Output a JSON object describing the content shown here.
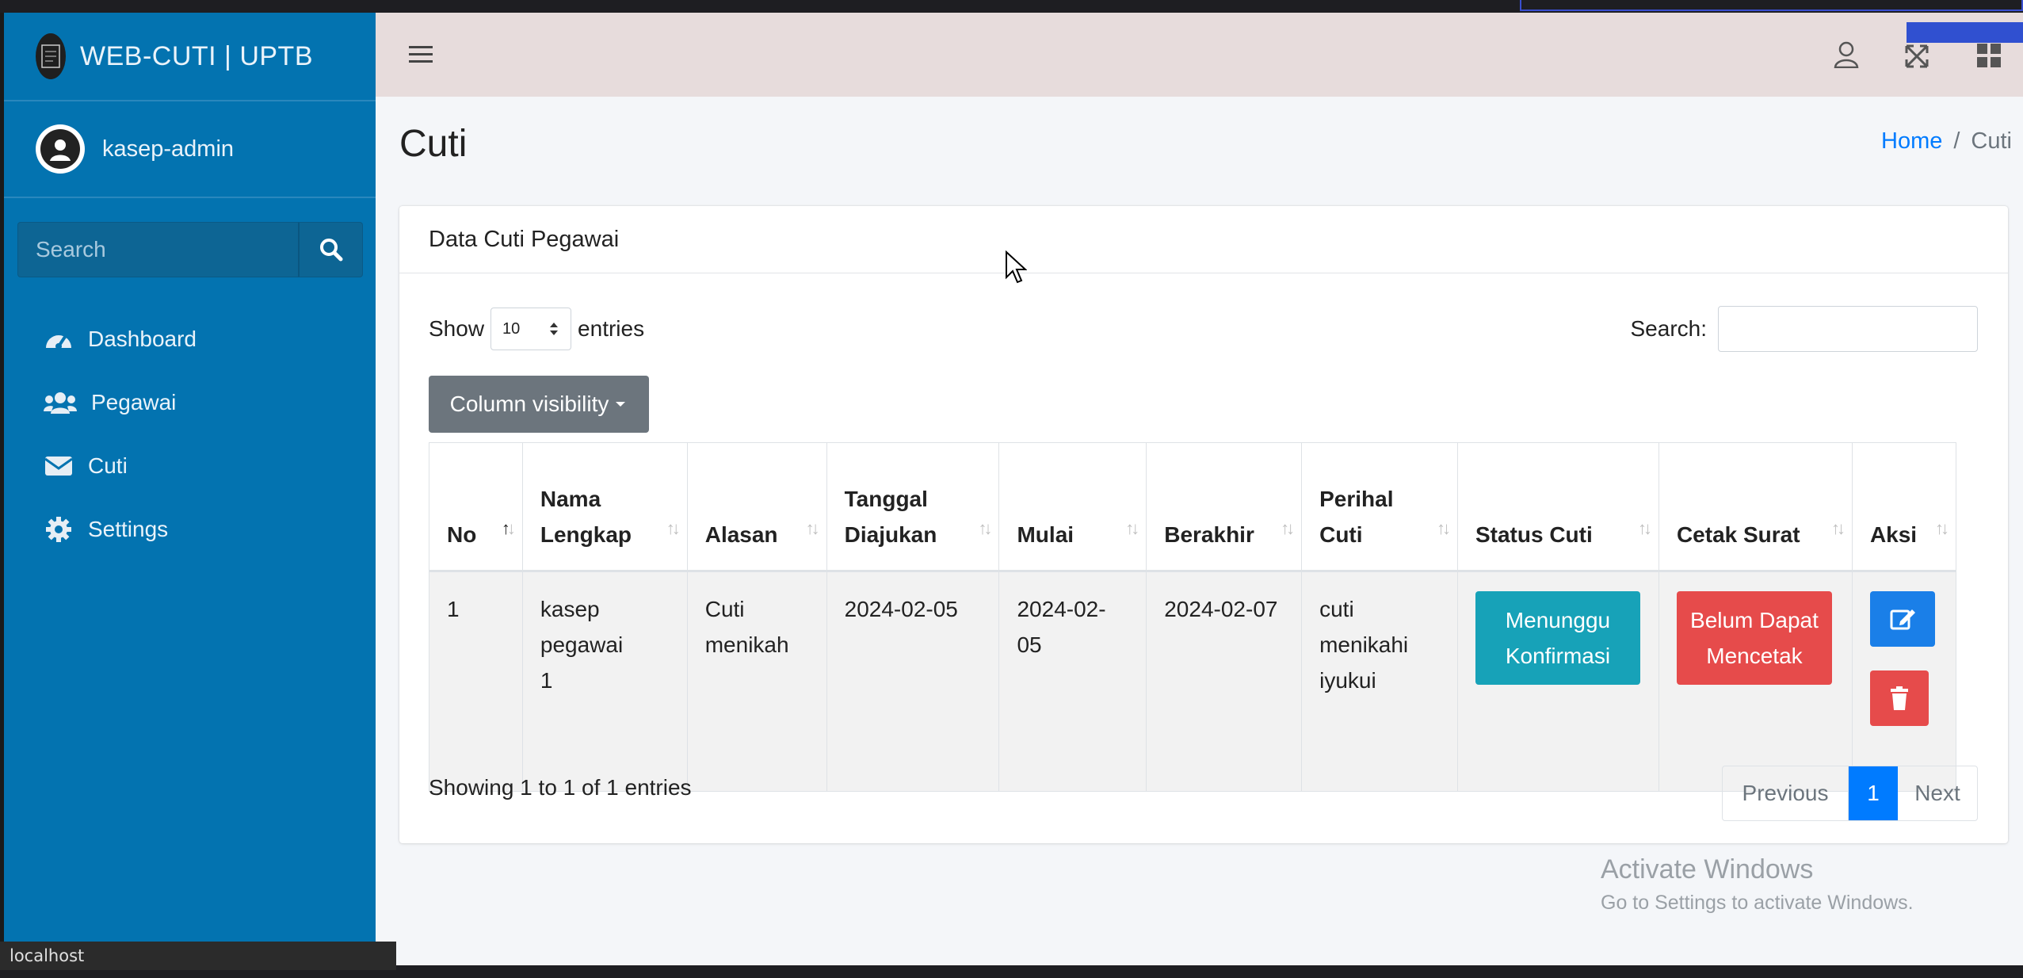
{
  "app": {
    "brand": "WEB-CUTI | UPTB",
    "user": "kasep-admin"
  },
  "sidebar": {
    "search_placeholder": "Search",
    "items": [
      {
        "label": "Dashboard",
        "icon": "tachometer-icon"
      },
      {
        "label": "Pegawai",
        "icon": "users-icon"
      },
      {
        "label": "Cuti",
        "icon": "envelope-icon"
      },
      {
        "label": "Settings",
        "icon": "gear-icon"
      }
    ]
  },
  "header": {
    "page_title": "Cuti",
    "breadcrumb": [
      "Home",
      "Cuti"
    ]
  },
  "card": {
    "title": "Data Cuti Pegawai",
    "show_label": "Show",
    "entries_label": "entries",
    "page_length": "10",
    "search_label": "Search:",
    "column_visibility": "Column visibility",
    "columns": [
      "No",
      "Nama Lengkap",
      "Alasan",
      "Tanggal Diajukan",
      "Mulai",
      "Berakhir",
      "Perihal Cuti",
      "Status Cuti",
      "Cetak Surat",
      "Aksi"
    ],
    "rows": [
      {
        "no": "1",
        "nama": "kasep pegawai 1",
        "alasan": "Cuti menikah",
        "tanggal": "2024-02-05",
        "mulai": "2024-02-05",
        "berakhir": "2024-02-07",
        "perihal": "cuti menikahi iyukui",
        "status": "Menunggu Konfirmasi",
        "cetak": "Belum Dapat Mencetak"
      }
    ],
    "info": "Showing 1 to 1 of 1 entries",
    "pagination": {
      "previous": "Previous",
      "current": "1",
      "next": "Next"
    }
  },
  "overlay": {
    "activate_title": "Activate Windows",
    "activate_sub": "Go to Settings to activate Windows."
  },
  "statusbar": "localhost",
  "colors": {
    "sidebar": "#0373b0",
    "info": "#17a2b8",
    "danger": "#e64b4b",
    "primary": "#007bff"
  }
}
